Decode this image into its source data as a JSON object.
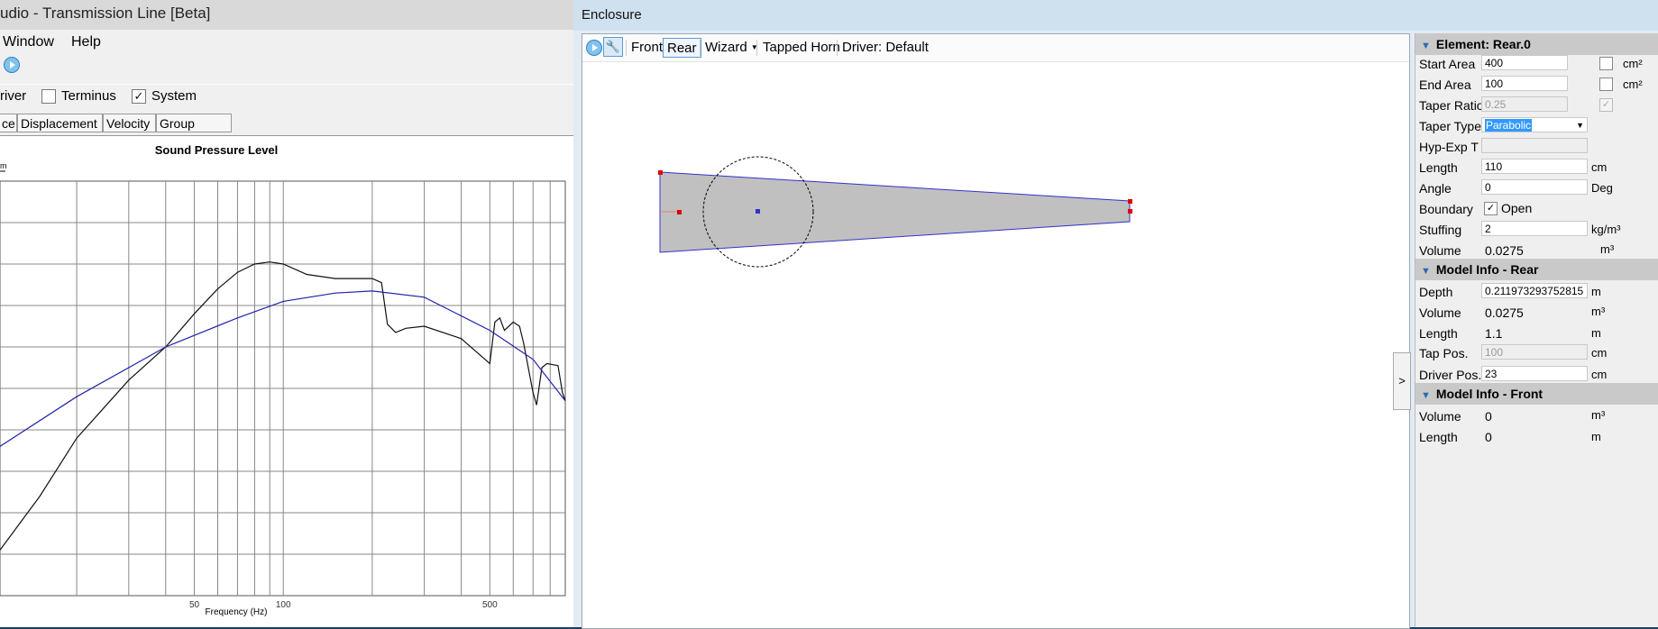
{
  "left_window": {
    "title": "udio - Transmission Line [Beta]",
    "menu": {
      "window": "Window",
      "help": "Help"
    },
    "options": {
      "driver_label": "river",
      "terminus_label": "Terminus",
      "terminus_checked": false,
      "system_label": "System",
      "system_checked": true
    },
    "tabs": [
      "ce",
      "Displacement",
      "Velocity",
      "Group Delay"
    ]
  },
  "chart_data": {
    "type": "line",
    "title": "Sound Pressure Level",
    "xlabel": "Frequency (Hz)",
    "x_scale": "log",
    "xlim": [
      11,
      900
    ],
    "x_ticks": [
      50,
      100,
      500
    ],
    "legend_fragment": "m",
    "ylim": [
      0,
      10
    ],
    "series": [
      {
        "color": "#111111",
        "x": [
          11,
          15,
          20,
          30,
          40,
          50,
          60,
          70,
          80,
          90,
          100,
          120,
          150,
          200,
          215,
          225,
          240,
          260,
          300,
          400,
          500,
          520,
          540,
          560,
          600,
          630,
          650,
          700,
          720,
          750,
          780,
          850,
          880,
          900
        ],
        "y": [
          1.1,
          2.4,
          3.8,
          5.2,
          6.0,
          6.8,
          7.4,
          7.8,
          8.0,
          8.05,
          8.0,
          7.75,
          7.65,
          7.65,
          7.55,
          6.55,
          6.35,
          6.45,
          6.5,
          6.2,
          5.6,
          6.6,
          6.7,
          6.4,
          6.6,
          6.5,
          6.1,
          4.9,
          4.6,
          5.5,
          5.6,
          5.55,
          4.9,
          4.7
        ]
      },
      {
        "color": "#2222aa",
        "x": [
          11,
          20,
          40,
          70,
          100,
          150,
          200,
          300,
          500,
          700,
          900
        ],
        "y": [
          3.6,
          4.8,
          6.0,
          6.7,
          7.1,
          7.3,
          7.35,
          7.2,
          6.4,
          5.7,
          4.7
        ]
      }
    ]
  },
  "enclosure": {
    "title": "Enclosure",
    "toolbar": {
      "front": "Front",
      "rear": "Rear",
      "wizard": "Wizard",
      "tapped_horn": "Tapped Horn",
      "driver": "Driver: Default"
    },
    "collapse_label": ">"
  },
  "properties": {
    "element": {
      "header": "Element: Rear.0",
      "start_area": {
        "label": "Start Area",
        "value": "400",
        "unit": "cm²"
      },
      "end_area": {
        "label": "End Area",
        "value": "100",
        "unit": "cm²"
      },
      "taper_ratio": {
        "label": "Taper Ratio",
        "value": "0.25"
      },
      "taper_type": {
        "label": "Taper Type",
        "value": "Parabolic"
      },
      "hyp_exp": {
        "label": "Hyp-Exp T",
        "value": ""
      },
      "length": {
        "label": "Length",
        "value": "110",
        "unit": "cm"
      },
      "angle": {
        "label": "Angle",
        "value": "0",
        "unit": "Deg"
      },
      "boundary": {
        "label": "Boundary",
        "value": "Open",
        "checked": true
      },
      "stuffing": {
        "label": "Stuffing",
        "value": "2",
        "unit": "kg/m³"
      },
      "volume": {
        "label": "Volume",
        "value": "0.0275",
        "unit": "m³"
      }
    },
    "model_rear": {
      "header": "Model Info - Rear",
      "depth": {
        "label": "Depth",
        "value": "0.211973293752815",
        "unit": "m"
      },
      "volume": {
        "label": "Volume",
        "value": "0.0275",
        "unit": "m³"
      },
      "length": {
        "label": "Length",
        "value": "1.1",
        "unit": "m"
      },
      "tap_pos": {
        "label": "Tap Pos.",
        "value": "100",
        "unit": "cm"
      },
      "driver_pos": {
        "label": "Driver Pos.",
        "value": "23",
        "unit": "cm"
      }
    },
    "model_front": {
      "header": "Model Info - Front",
      "volume": {
        "label": "Volume",
        "value": "0",
        "unit": "m³"
      },
      "length": {
        "label": "Length",
        "value": "0",
        "unit": "m"
      }
    }
  }
}
